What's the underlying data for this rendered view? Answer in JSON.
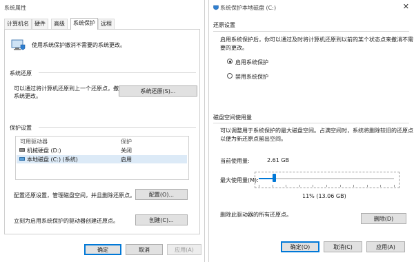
{
  "left_window": {
    "title": "系统属性",
    "tabs": [
      {
        "label": "计算机名"
      },
      {
        "label": "硬件"
      },
      {
        "label": "高级"
      },
      {
        "label": "系统保护",
        "active": true
      },
      {
        "label": "远程"
      }
    ],
    "intro": "使用系统保护撤消不需要的系统更改。",
    "restore": {
      "title": "系统还原",
      "desc_line1": "可以通过将计算机还原到上一个还原点，撤消",
      "desc_line2": "系统更改。",
      "button": "系统还原(S)..."
    },
    "protection": {
      "title": "保护设置",
      "col_drive": "可用驱动器",
      "col_protect": "保护",
      "rows": [
        {
          "drive": "机械硬盘 (D:)",
          "status": "关闭",
          "selected": false
        },
        {
          "drive": "本地磁盘 (C:) (系统)",
          "status": "启用",
          "selected": true
        }
      ],
      "config_text": "配置还原设置，管理磁盘空间，并且删除还原点。",
      "config_button": "配置(O)...",
      "create_text": "立刻为启用系统保护的驱动器创建还原点。",
      "create_button": "创建(C)..."
    },
    "footer": {
      "ok": "确定",
      "cancel": "取消",
      "apply": "应用(A)"
    }
  },
  "right_window": {
    "title": "系统保护本地磁盘 (C:)",
    "restore_settings": {
      "title": "还原设置",
      "desc_line1": "启用系统保护后，你可以通过及时将计算机还原到以前的某个状态点来撤消不需",
      "desc_line2": "要的更改。",
      "options": [
        {
          "label": "启用系统保护",
          "checked": true
        },
        {
          "label": "禁用系统保护",
          "checked": false
        }
      ]
    },
    "disk_usage": {
      "title": "磁盘空间使用量",
      "desc_line1": "可以调整用于系统保护的最大磁盘空间。占满空间时，系统将删除较旧的还原点",
      "desc_line2": "以便为新还原点留出空间。",
      "current_label": "当前使用量:",
      "current_value": "2.61 GB",
      "max_label": "最大使用量(M):",
      "slider_fraction": 0.11,
      "slider_value_text": "11% (13.06 GB)",
      "delete_text": "删除此驱动器的所有还原点。",
      "delete_button": "删除(D)"
    },
    "footer": {
      "ok": "确定(O)",
      "cancel": "取消(C)",
      "apply": "应用(A)"
    }
  },
  "colors": {
    "accent": "#0078d7",
    "selected_row": "#dceaf7"
  }
}
